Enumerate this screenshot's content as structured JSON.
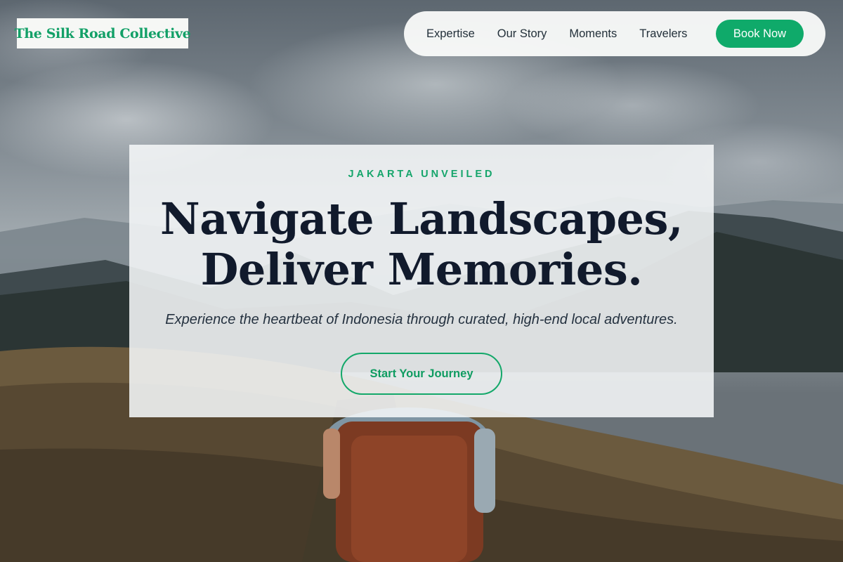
{
  "brand": {
    "logo_text": "The Silk Road Collective"
  },
  "nav": {
    "links": [
      "Expertise",
      "Our Story",
      "Moments",
      "Travelers"
    ],
    "cta_label": "Book Now"
  },
  "hero": {
    "eyebrow": "JAKARTA UNVEILED",
    "headline_line1": "Navigate Landscapes,",
    "headline_line2": "Deliver Memories.",
    "subtitle": "Experience the heartbeat of Indonesia through curated, high-end local adventures.",
    "cta_label": "Start Your Journey",
    "background_image": "hiker-on-mountain-trail"
  },
  "colors": {
    "accent": "#0faa6a",
    "heading": "#111a2c",
    "nav_bg": "#fafbfa",
    "card_bg": "#f5f7f8"
  }
}
